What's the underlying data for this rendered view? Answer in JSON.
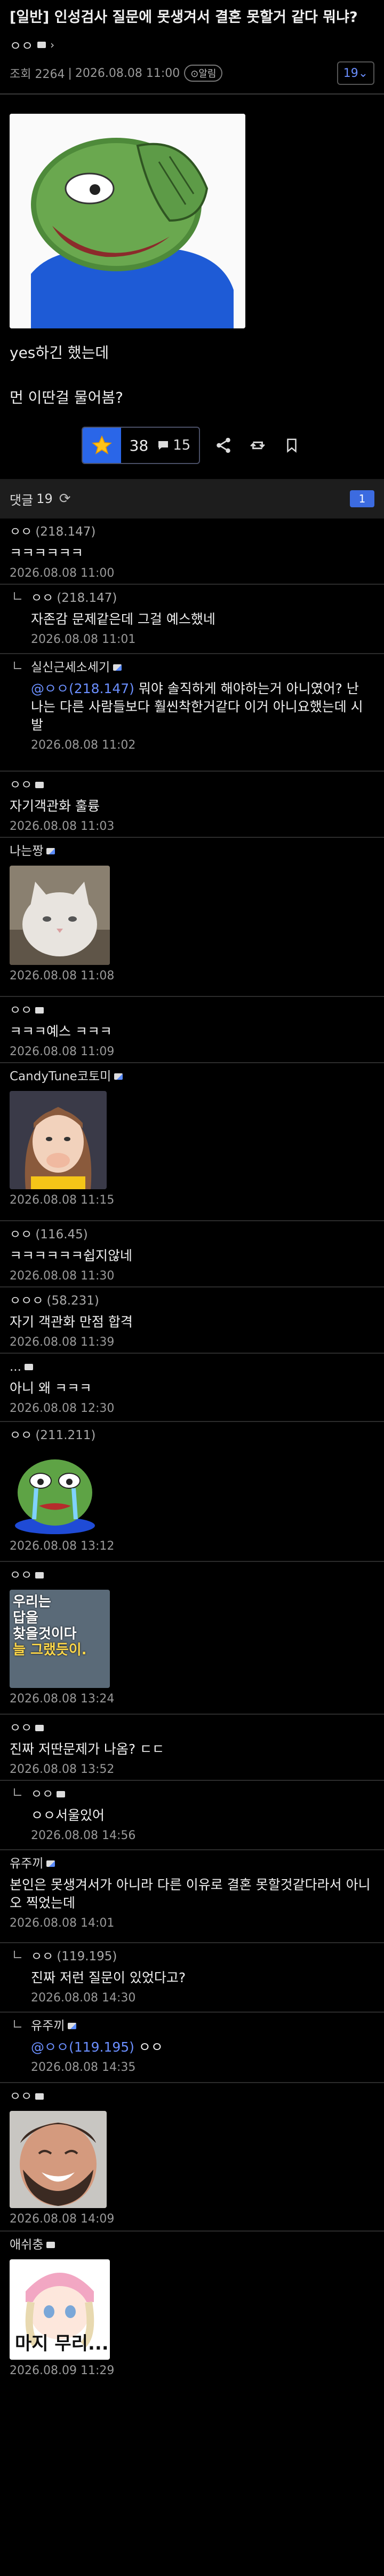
{
  "post": {
    "title": "[일반] 인성검사 질문에 못생겨서 결혼 못할거 같다 뭐냐?",
    "author": "ㅇㅇ",
    "views_label": "조회 2264",
    "date": "2026.08.08 11:00",
    "notify_label": "알림",
    "page_count": "19",
    "body_lines": [
      "yes하긴 했는데",
      "먼 이딴걸 물어봄?"
    ],
    "star_count": "38",
    "comment_count": "15"
  },
  "comments_bar": {
    "label": "댓글",
    "count": "19",
    "page": "1"
  },
  "comments": [
    {
      "author": "ㅇㅇ",
      "ip": "(218.147)",
      "text": "ㅋㅋㅋㅋㅋㅋ",
      "time": "2026.08.08 11:00"
    },
    {
      "author": "ㅇㅇ",
      "ip": "(218.147)",
      "text": "자존감 문제같은데 그걸 예스했네",
      "time": "2026.08.08 11:01"
    },
    {
      "author": "실신근세소세기",
      "mention": "@ㅇㅇ(218.147)",
      "text": " 뭐야 솔직하게 해야하는거 아니였어? 난 나는 다른 사람들보다 훨씬착한거같다 이거 아니요했는데 시발",
      "time": "2026.08.08 11:02"
    },
    {
      "author": "ㅇㅇ",
      "text": "자기객관화 훌륭",
      "time": "2026.08.08 11:03"
    },
    {
      "author": "나는짱",
      "time": "2026.08.08 11:08"
    },
    {
      "author": "ㅇㅇ",
      "text": "ㅋㅋㅋ예스 ㅋㅋㅋ",
      "time": "2026.08.08 11:09"
    },
    {
      "author": "CandyTune코토미",
      "time": "2026.08.08 11:15"
    },
    {
      "author": "ㅇㅇ",
      "ip": "(116.45)",
      "text": "ㅋㅋㅋㅋㅋㅋ쉽지않네",
      "time": "2026.08.08 11:30"
    },
    {
      "author": "ㅇㅇㅇ",
      "ip": "(58.231)",
      "text": "자기 객관화 만점 합격",
      "time": "2026.08.08 11:39"
    },
    {
      "author": "...",
      "text": "아니 왜 ㅋㅋㅋ",
      "time": "2026.08.08 12:30"
    },
    {
      "author": "ㅇㅇ",
      "ip": "(211.211)",
      "time": "2026.08.08 13:12"
    },
    {
      "author": "ㅇㅇ",
      "image_text": [
        "우리는",
        "답을",
        "찾을것이다",
        "늘 그랬듯이."
      ],
      "time": "2026.08.08 13:24"
    },
    {
      "author": "ㅇㅇ",
      "text": "진짜 저딴문제가 나옴? ㄷㄷ",
      "time": "2026.08.08 13:52"
    },
    {
      "author": "ㅇㅇ",
      "text": "ㅇㅇ서울있어",
      "time": "2026.08.08 14:56"
    },
    {
      "author": "유주끼",
      "text": "본인은 못생겨서가 아니라 다른 이유로 결혼 못할것같다라서 아니오 찍었는데",
      "time": "2026.08.08 14:01"
    },
    {
      "author": "ㅇㅇ",
      "ip": "(119.195)",
      "text": "진짜 저런 질문이 있었다고?",
      "time": "2026.08.08 14:30"
    },
    {
      "author": "유주끼",
      "mention": "@ㅇㅇ(119.195)",
      "text": " ㅇㅇ",
      "time": "2026.08.08 14:35"
    },
    {
      "author": "ㅇㅇ",
      "time": "2026.08.08 14:09"
    },
    {
      "author": "애쉬충",
      "image_text": [
        "마지 무리..."
      ],
      "time": "2026.08.09 11:29"
    }
  ],
  "colors": {
    "accent": "#2a66e8",
    "link": "#6b8fff",
    "background": "#000000"
  }
}
